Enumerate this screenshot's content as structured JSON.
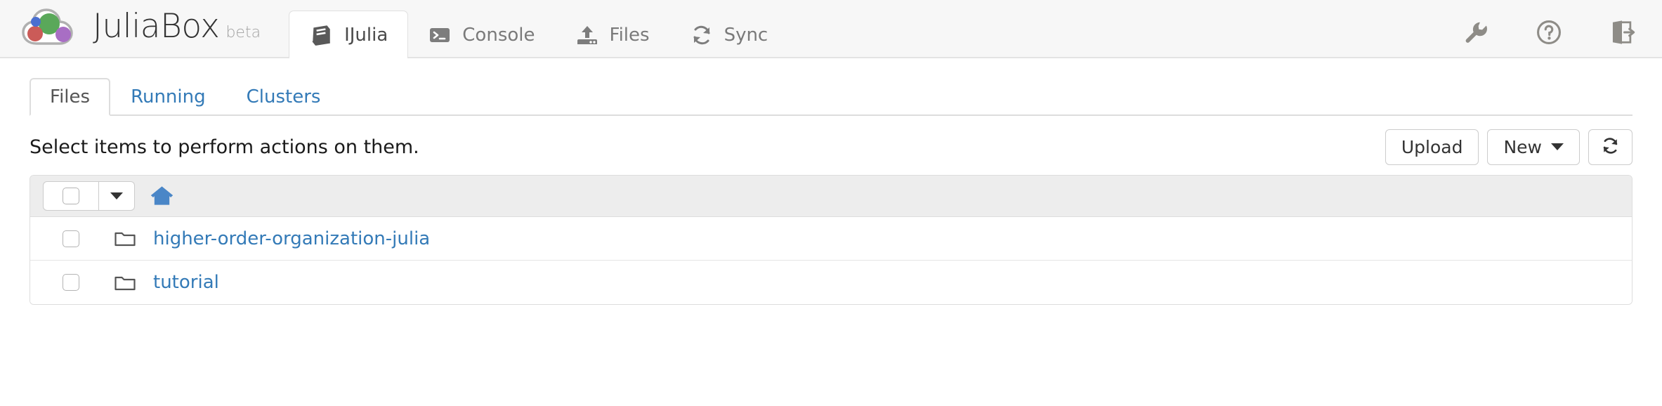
{
  "brand": {
    "name": "JuliaBox",
    "beta": "beta",
    "logo_icon": "juliabox-cloud-logo",
    "logo_colors": {
      "green": "#5aa85a",
      "red": "#cb5b58",
      "blue": "#4a6fd0",
      "purple": "#a86ec4",
      "outline": "#b0b0b0"
    }
  },
  "nav": {
    "tabs": [
      {
        "label": "IJulia",
        "icon": "book-icon",
        "active": true
      },
      {
        "label": "Console",
        "icon": "terminal-icon",
        "active": false
      },
      {
        "label": "Files",
        "icon": "upload-hdd-icon",
        "active": false
      },
      {
        "label": "Sync",
        "icon": "sync-refresh-icon",
        "active": false
      }
    ],
    "right_icons": [
      {
        "name": "wrench-icon",
        "title": "Settings"
      },
      {
        "name": "help-circle-icon",
        "title": "Help"
      },
      {
        "name": "sign-out-icon",
        "title": "Sign out"
      }
    ]
  },
  "subtabs": [
    {
      "label": "Files",
      "active": true
    },
    {
      "label": "Running",
      "active": false
    },
    {
      "label": "Clusters",
      "active": false
    }
  ],
  "actions": {
    "message": "Select items to perform actions on them.",
    "upload_label": "Upload",
    "new_label": "New",
    "refresh_icon": "refresh-icon"
  },
  "filelist": {
    "toolbar": {
      "select_all_checkbox": "",
      "select_dropdown_icon": "caret-down-icon",
      "breadcrumb_home_icon": "home-icon"
    },
    "rows": [
      {
        "name": "higher-order-organization-julia",
        "icon": "folder-icon",
        "checked": false
      },
      {
        "name": "tutorial",
        "icon": "folder-icon",
        "checked": false
      }
    ]
  },
  "colors": {
    "link": "#337ab7",
    "header_bg": "#f7f7f7",
    "panel_head_bg": "#ededed",
    "border": "#dddddd"
  }
}
